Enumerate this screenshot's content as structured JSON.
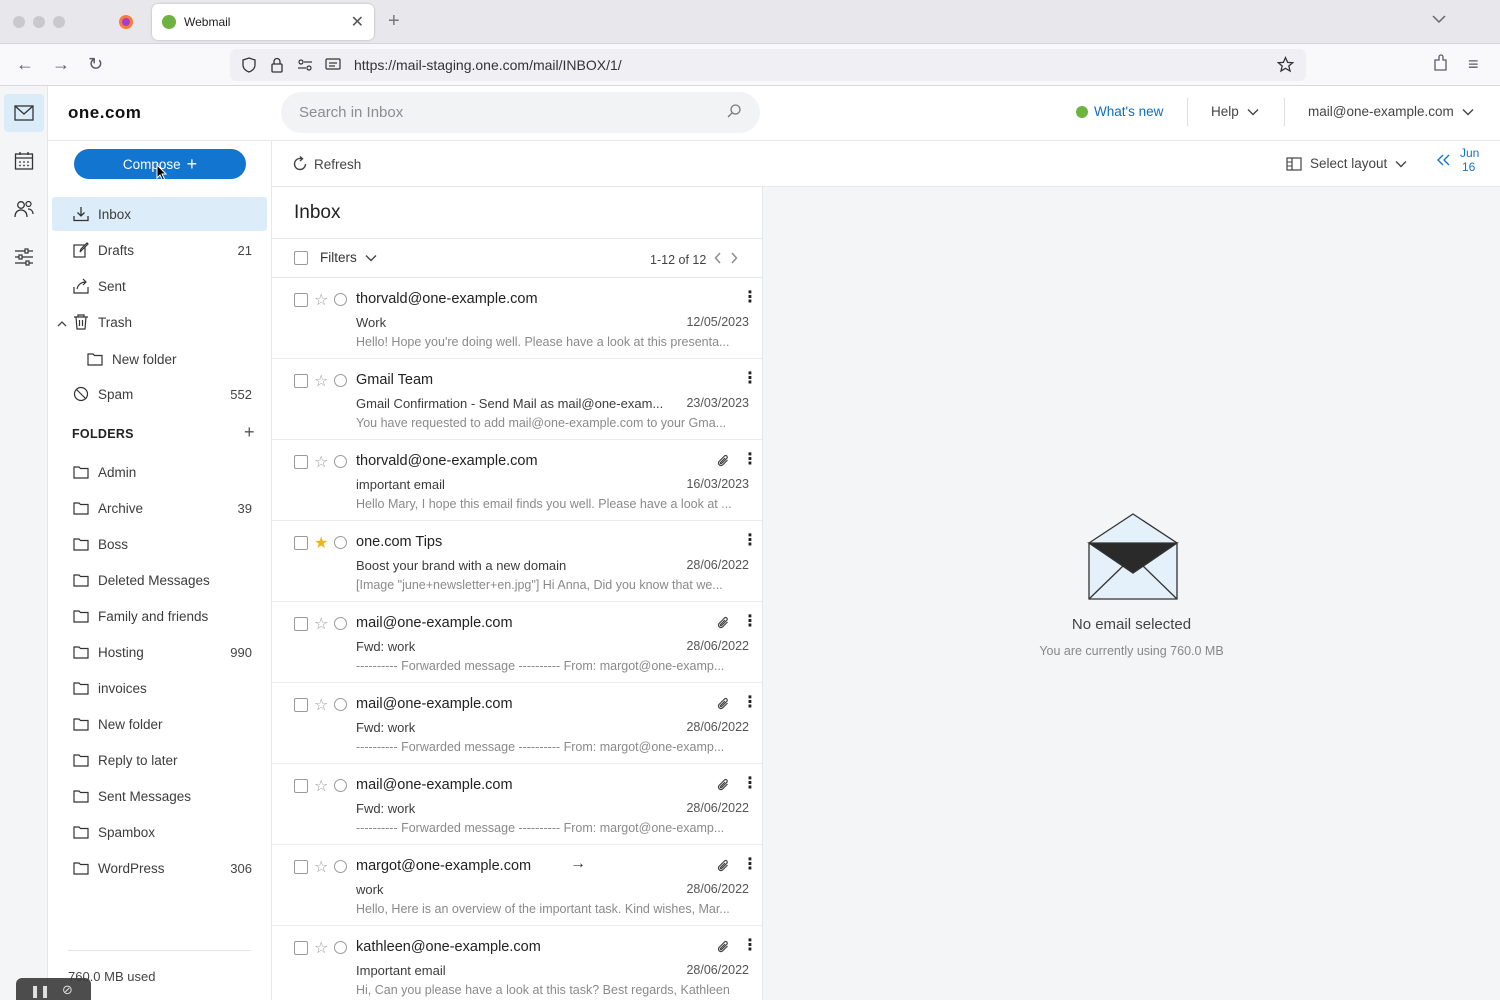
{
  "browser": {
    "tab_title": "Webmail",
    "url": "https://mail-staging.one.com/mail/INBOX/1/"
  },
  "header": {
    "logo": "one.com",
    "search_placeholder": "Search in Inbox",
    "whats_new": "What's new",
    "help": "Help",
    "account": "mail@one-example.com"
  },
  "sidebar": {
    "compose": "Compose",
    "system_folders": [
      {
        "label": "Inbox",
        "count": ""
      },
      {
        "label": "Drafts",
        "count": "21"
      },
      {
        "label": "Sent",
        "count": ""
      },
      {
        "label": "Trash",
        "count": ""
      },
      {
        "label": "New folder",
        "count": ""
      },
      {
        "label": "Spam",
        "count": "552"
      }
    ],
    "folders_header": "FOLDERS",
    "folders": [
      {
        "label": "Admin",
        "count": ""
      },
      {
        "label": "Archive",
        "count": "39"
      },
      {
        "label": "Boss",
        "count": ""
      },
      {
        "label": "Deleted Messages",
        "count": ""
      },
      {
        "label": "Family and friends",
        "count": ""
      },
      {
        "label": "Hosting",
        "count": "990"
      },
      {
        "label": "invoices",
        "count": ""
      },
      {
        "label": "New folder",
        "count": ""
      },
      {
        "label": "Reply to later",
        "count": ""
      },
      {
        "label": "Sent Messages",
        "count": ""
      },
      {
        "label": "Spambox",
        "count": ""
      },
      {
        "label": "WordPress",
        "count": "306"
      }
    ],
    "usage": "760.0 MB used"
  },
  "toolbar": {
    "refresh": "Refresh",
    "select_layout": "Select layout",
    "date_month": "Jun",
    "date_day": "16"
  },
  "list": {
    "title": "Inbox",
    "filters": "Filters",
    "pager": "1-12 of 12",
    "messages": [
      {
        "from": "thorvald@one-example.com",
        "subject": "Work",
        "date": "12/05/2023",
        "preview": "Hello! Hope you're doing well. Please have a look at this presenta...",
        "starred": false,
        "attachment": false,
        "forwarded": false
      },
      {
        "from": "Gmail Team",
        "subject": "Gmail Confirmation - Send Mail as mail@one-exam...",
        "date": "23/03/2023",
        "preview": "You have requested to add mail@one-example.com to your Gma...",
        "starred": false,
        "attachment": false,
        "forwarded": false
      },
      {
        "from": "thorvald@one-example.com",
        "subject": "important email",
        "date": "16/03/2023",
        "preview": "Hello Mary, I hope this email finds you well. Please have a look at ...",
        "starred": false,
        "attachment": true,
        "forwarded": false
      },
      {
        "from": "one.com Tips",
        "subject": "Boost your brand with a new domain",
        "date": "28/06/2022",
        "preview": "[Image \"june+newsletter+en.jpg\"] Hi Anna, Did you know that we...",
        "starred": true,
        "attachment": false,
        "forwarded": false
      },
      {
        "from": "mail@one-example.com",
        "subject": "Fwd: work",
        "date": "28/06/2022",
        "preview": "---------- Forwarded message ---------- From: margot@one-examp...",
        "starred": false,
        "attachment": true,
        "forwarded": false
      },
      {
        "from": "mail@one-example.com",
        "subject": "Fwd: work",
        "date": "28/06/2022",
        "preview": "---------- Forwarded message ---------- From: margot@one-examp...",
        "starred": false,
        "attachment": true,
        "forwarded": false
      },
      {
        "from": "mail@one-example.com",
        "subject": "Fwd: work",
        "date": "28/06/2022",
        "preview": "---------- Forwarded message ---------- From: margot@one-examp...",
        "starred": false,
        "attachment": true,
        "forwarded": false
      },
      {
        "from": "margot@one-example.com",
        "subject": "work",
        "date": "28/06/2022",
        "preview": "Hello, Here is an overview of the important task. Kind wishes, Mar...",
        "starred": false,
        "attachment": true,
        "forwarded": true
      },
      {
        "from": "kathleen@one-example.com",
        "subject": "Important email",
        "date": "28/06/2022",
        "preview": "Hi, Can you please have a look at this task? Best regards, Kathleen",
        "starred": false,
        "attachment": true,
        "forwarded": false
      }
    ]
  },
  "reading_pane": {
    "empty_title": "No email selected",
    "empty_sub": "You are currently using 760.0 MB"
  },
  "colors": {
    "accent": "#1275cf",
    "green": "#6cb33f",
    "star": "#f2b21b",
    "active_bg": "#dcedf9"
  }
}
